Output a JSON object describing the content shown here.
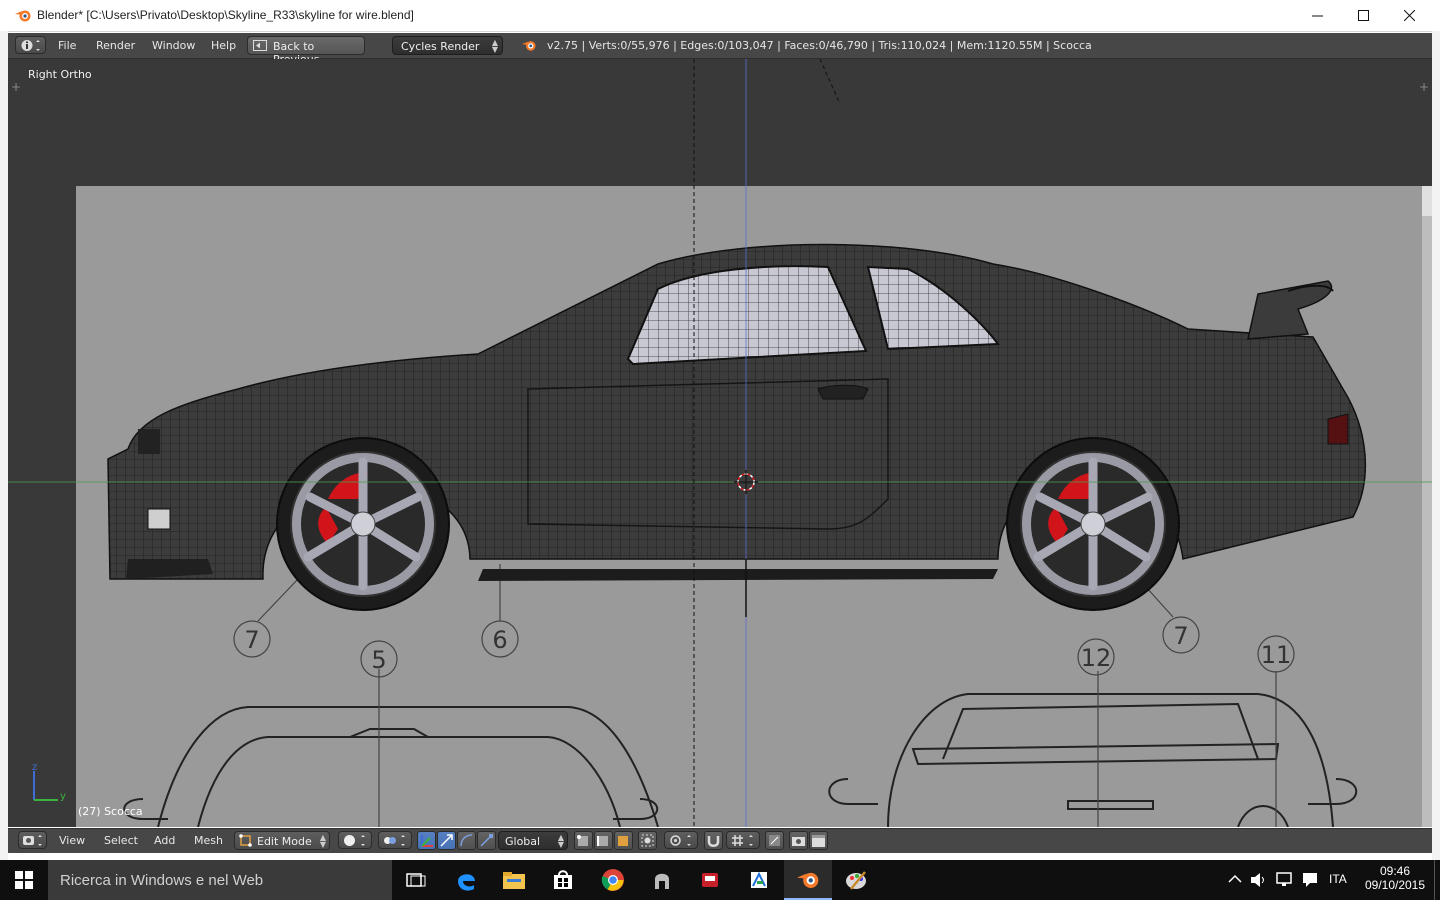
{
  "window": {
    "title": "Blender* [C:\\Users\\Privato\\Desktop\\Skyline_R33\\skyline for wire.blend]",
    "controls": [
      "minimize-icon",
      "maximize-icon",
      "close-icon"
    ]
  },
  "info_header": {
    "menus": [
      "File",
      "Render",
      "Window",
      "Help"
    ],
    "back_button": "Back to Previous",
    "render_engine": "Cycles Render",
    "stats": "v2.75 | Verts:0/55,976 | Edges:0/103,047 | Faces:0/46,790 | Tris:110,024 | Mem:1120.55M | Scocca"
  },
  "viewport": {
    "view_name": "Right Ortho",
    "object_label": "(27) Scocca",
    "axis_labels": {
      "z": "z",
      "y": "y"
    },
    "blueprint_numbers": [
      "7",
      "6",
      "7",
      "5",
      "12",
      "11"
    ]
  },
  "view_header": {
    "menus": [
      "View",
      "Select",
      "Add",
      "Mesh"
    ],
    "mode": "Edit Mode",
    "orientation": "Global"
  },
  "taskbar": {
    "search_placeholder": "Ricerca in Windows e nel Web",
    "apps": [
      "task-view-icon",
      "edge-icon",
      "file-explorer-icon",
      "store-icon",
      "chrome-icon",
      "app-icon",
      "app-red-icon",
      "app-green-icon",
      "blender-icon",
      "paint-icon"
    ],
    "language": "ITA",
    "time": "09:46",
    "date": "09/10/2015"
  },
  "colors": {
    "blender_header": "#474747",
    "viewport_bg": "#393939",
    "blueprint_bg": "#9a9a9a",
    "car_body": "#3a3a3a",
    "caliper": "#d0141a",
    "taskbar": "#0f0f0f"
  }
}
